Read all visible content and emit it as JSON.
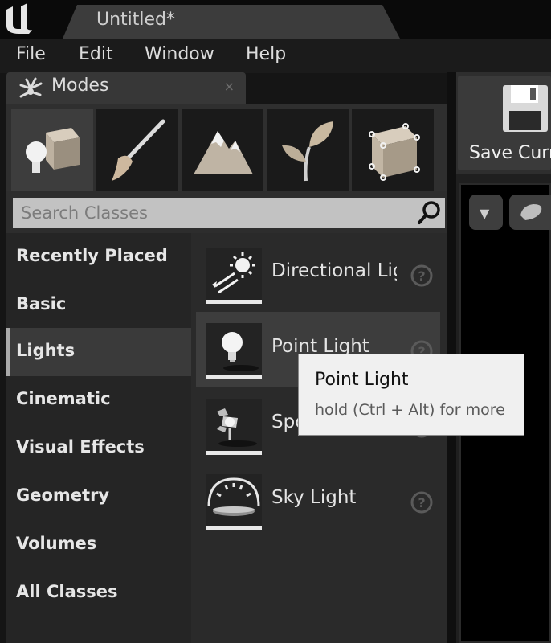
{
  "window": {
    "document_title": "Untitled*"
  },
  "menu": [
    "File",
    "Edit",
    "Window",
    "Help"
  ],
  "modes_panel": {
    "title": "Modes",
    "close_glyph": "×",
    "mode_buttons": [
      {
        "name": "place-mode",
        "icon": "place-icon",
        "active": true
      },
      {
        "name": "paint-mode",
        "icon": "brush-icon",
        "active": false
      },
      {
        "name": "landscape-mode",
        "icon": "mountain-icon",
        "active": false
      },
      {
        "name": "foliage-mode",
        "icon": "leaf-icon",
        "active": false
      },
      {
        "name": "geometry-mode",
        "icon": "cube-edit-icon",
        "active": false
      }
    ],
    "search": {
      "placeholder": "Search Classes",
      "value": ""
    },
    "categories": [
      "Recently Placed",
      "Basic",
      "Lights",
      "Cinematic",
      "Visual Effects",
      "Geometry",
      "Volumes",
      "All Classes"
    ],
    "selected_category": "Lights",
    "items": [
      {
        "label": "Directional Light",
        "icon": "directional-light-icon"
      },
      {
        "label": "Point Light",
        "icon": "point-light-icon"
      },
      {
        "label": "Spot Light",
        "icon": "spot-light-icon"
      },
      {
        "label": "Sky Light",
        "icon": "sky-light-icon"
      }
    ],
    "hovered_item": "Point Light"
  },
  "tooltip": {
    "title": "Point Light",
    "hint": "hold (Ctrl + Alt) for more"
  },
  "toolbar": {
    "save_label": "Save Current"
  },
  "colors": {
    "panel_bg": "#2a2a2a",
    "selected_row": "#3a3a3a",
    "tooltip_bg": "#f0f0f0",
    "search_bg": "#c2c2c2"
  }
}
